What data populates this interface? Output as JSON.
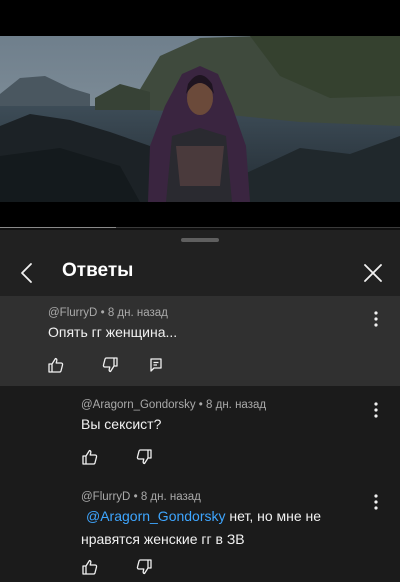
{
  "header": {
    "title": "Ответы"
  },
  "video": {
    "progress_fraction": 0.29
  },
  "comments": [
    {
      "author": "@FlurryD",
      "separator": "•",
      "time": "8 дн. назад",
      "text": "Опять гг женщина..."
    },
    {
      "author": "@Aragorn_Gondorsky",
      "separator": "•",
      "time": "8 дн. назад",
      "text": "Вы сексист?"
    },
    {
      "author": "@FlurryD",
      "separator": "•",
      "time": "8 дн. назад",
      "mention": "@Aragorn_Gondorsky",
      "text_after_mention": " нет, но мне не",
      "text_line2": "нравятся женские гг в ЗВ"
    }
  ],
  "icons": {
    "back": "chevron-left-icon",
    "close": "close-icon",
    "more": "more-vertical-icon",
    "like": "thumb-up-icon",
    "dislike": "thumb-down-icon",
    "reply": "reply-comment-icon"
  }
}
